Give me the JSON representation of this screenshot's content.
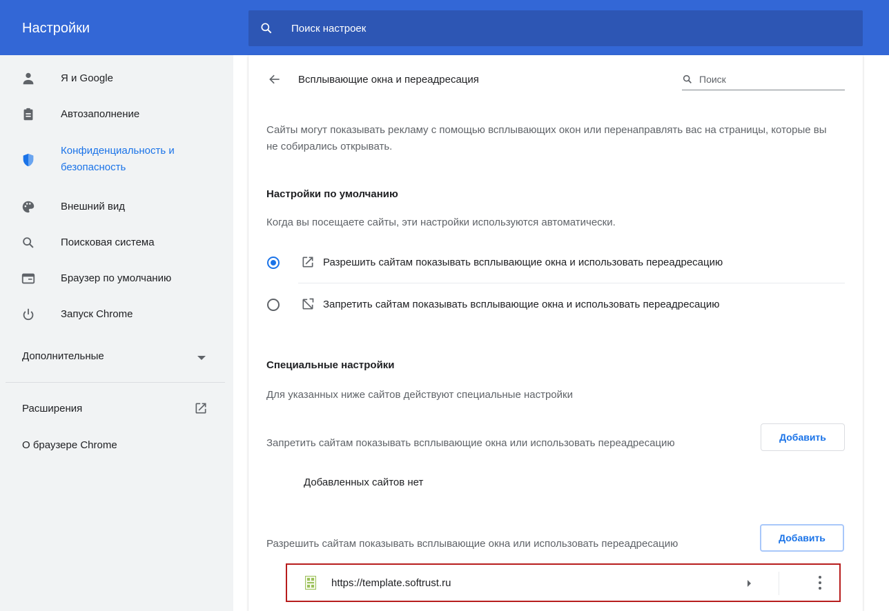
{
  "header": {
    "app_title": "Настройки",
    "search_placeholder": "Поиск настроек"
  },
  "sidebar": {
    "items": [
      {
        "label": "Я и Google",
        "icon": "person-icon"
      },
      {
        "label": "Автозаполнение",
        "icon": "clipboard-icon"
      },
      {
        "label": "Конфиденциальность и безопасность",
        "icon": "shield-icon",
        "active": true
      },
      {
        "label": "Внешний вид",
        "icon": "palette-icon"
      },
      {
        "label": "Поисковая система",
        "icon": "search-icon"
      },
      {
        "label": "Браузер по умолчанию",
        "icon": "browser-window-icon"
      },
      {
        "label": "Запуск Chrome",
        "icon": "power-icon"
      }
    ],
    "advanced_label": "Дополнительные",
    "extensions_label": "Расширения",
    "about_label": "О браузере Chrome"
  },
  "page": {
    "title": "Всплывающие окна и переадресация",
    "search_placeholder": "Поиск",
    "description": "Сайты могут показывать рекламу с помощью всплывающих окон или перенаправлять вас на страницы, которые вы не собирались открывать.",
    "default_heading": "Настройки по умолчанию",
    "default_sub": "Когда вы посещаете сайты, эти настройки используются автоматически.",
    "options": [
      {
        "label": "Разрешить сайтам показывать всплывающие окна и использовать переадресацию",
        "selected": true,
        "icon": "open-in-new-icon"
      },
      {
        "label": "Запретить сайтам показывать всплывающие окна и использовать переадресацию",
        "selected": false,
        "icon": "popup-blocked-icon"
      }
    ],
    "special_heading": "Специальные настройки",
    "special_sub": "Для указанных ниже сайтов действуют специальные настройки",
    "block_section": {
      "label": "Запретить сайтам показывать всплывающие окна или использовать переадресацию",
      "add_label": "Добавить",
      "empty_text": "Добавленных сайтов нет"
    },
    "allow_section": {
      "label": "Разрешить сайтам показывать всплывающие окна или использовать переадресацию",
      "add_label": "Добавить",
      "sites": [
        {
          "url": "https://template.softrust.ru"
        }
      ]
    }
  },
  "colors": {
    "header_bg": "#3367d6",
    "search_bg": "#2d56b4",
    "accent": "#1a73e8",
    "sidebar_bg": "#f1f3f4",
    "highlight_border": "#b71c1c"
  }
}
